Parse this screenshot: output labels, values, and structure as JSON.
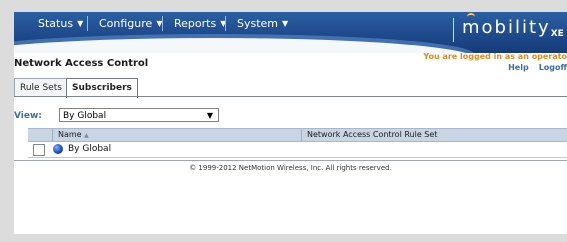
{
  "menu": {
    "items": [
      {
        "label": "Status"
      },
      {
        "label": "Configure"
      },
      {
        "label": "Reports"
      },
      {
        "label": "System"
      }
    ]
  },
  "brand": {
    "logo_text": "mobility",
    "logo_suffix": "XE"
  },
  "header": {
    "page_title": "Network Access Control",
    "login_message": "You are logged in as an operato",
    "help_link": "Help",
    "logoff_link": "Logoff"
  },
  "tabs": [
    {
      "label": "Rule Sets",
      "active": false
    },
    {
      "label": "Subscribers",
      "active": true
    }
  ],
  "view": {
    "label": "View:",
    "selected": "By Global"
  },
  "table": {
    "columns": [
      "Name",
      "Network Access Control Rule Set"
    ],
    "rows": [
      {
        "name": "By Global",
        "rule_set": "",
        "checked": false,
        "icon": "globe-icon"
      }
    ]
  },
  "footer": {
    "copyright": "© 1999-2012 NetMotion Wireless, Inc. All rights reserved."
  },
  "colors": {
    "topbar": "#1e4a8c",
    "accent_orange": "#e08a1e",
    "link_blue": "#3a6ea5",
    "table_header": "#c8d5e3"
  }
}
